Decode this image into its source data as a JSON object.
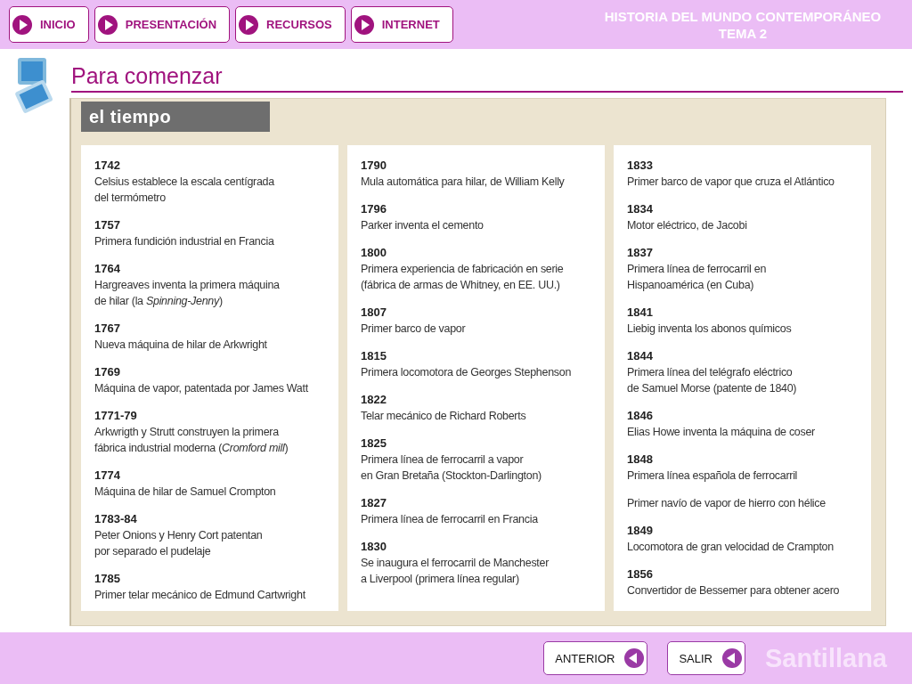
{
  "nav": [
    {
      "label": "INICIO"
    },
    {
      "label": "PRESENTACIÓN"
    },
    {
      "label": "RECURSOS"
    },
    {
      "label": "INTERNET"
    }
  ],
  "course": {
    "title": "HISTORIA DEL MUNDO CONTEMPORÁNEO",
    "subtitle": "TEMA 2"
  },
  "page_title": "Para comenzar",
  "panel": {
    "heading": "el tiempo",
    "columns": [
      [
        {
          "year": "1742",
          "text": "Celsius establece la escala centígrada\ndel termómetro"
        },
        {
          "year": "1757",
          "text": "Primera fundición industrial en Francia"
        },
        {
          "year": "1764",
          "text": "Hargreaves inventa la primera máquina\nde hilar (la *Spinning-Jenny*)"
        },
        {
          "year": "1767",
          "text": "Nueva máquina de hilar de Arkwright"
        },
        {
          "year": "1769",
          "text": "Máquina de vapor, patentada por James Watt"
        },
        {
          "year": "1771-79",
          "text": "Arkwrigth y Strutt construyen la primera\nfábrica industrial moderna (*Cromford mill*)"
        },
        {
          "year": "1774",
          "text": "Máquina de hilar de Samuel Crompton"
        },
        {
          "year": "1783-84",
          "text": "Peter Onions y Henry Cort patentan\npor separado el pudelaje"
        },
        {
          "year": "1785",
          "text": "Primer telar mecánico de Edmund Cartwright"
        }
      ],
      [
        {
          "year": "1790",
          "text": "Mula automática para hilar, de William Kelly"
        },
        {
          "year": "1796",
          "text": "Parker inventa el cemento"
        },
        {
          "year": "1800",
          "text": "Primera experiencia de fabricación en serie\n(fábrica de armas de Whitney, en EE. UU.)"
        },
        {
          "year": "1807",
          "text": "Primer barco de vapor"
        },
        {
          "year": "1815",
          "text": "Primera locomotora de Georges Stephenson"
        },
        {
          "year": "1822",
          "text": "Telar mecánico de Richard Roberts"
        },
        {
          "year": "1825",
          "text": "Primera línea de ferrocarril a vapor\nen Gran Bretaña (Stockton-Darlington)"
        },
        {
          "year": "1827",
          "text": "Primera línea de ferrocarril en Francia"
        },
        {
          "year": "1830",
          "text": "Se inaugura el ferrocarril de Manchester\na Liverpool (primera línea regular)"
        }
      ],
      [
        {
          "year": "1833",
          "text": "Primer barco de vapor que cruza el Atlántico"
        },
        {
          "year": "1834",
          "text": "Motor eléctrico, de Jacobi"
        },
        {
          "year": "1837",
          "text": "Primera línea de ferrocarril en\nHispanoamérica (en Cuba)"
        },
        {
          "year": "1841",
          "text": "Liebig inventa los abonos químicos"
        },
        {
          "year": "1844",
          "text": "Primera línea del telégrafo eléctrico\nde Samuel Morse (patente de 1840)"
        },
        {
          "year": "1846",
          "text": "Elias Howe inventa la máquina de coser"
        },
        {
          "year": "1848",
          "text": "Primera línea española de ferrocarril"
        },
        {
          "text": "Primer navío de vapor de hierro con hélice"
        },
        {
          "year": "1849",
          "text": "Locomotora de gran velocidad de Crampton"
        },
        {
          "year": "1856",
          "text": "Convertidor de Bessemer para obtener acero"
        }
      ]
    ]
  },
  "footer": {
    "buttons": [
      {
        "label": "ANTERIOR"
      },
      {
        "label": "SALIR"
      }
    ],
    "brand": "Santillana"
  }
}
